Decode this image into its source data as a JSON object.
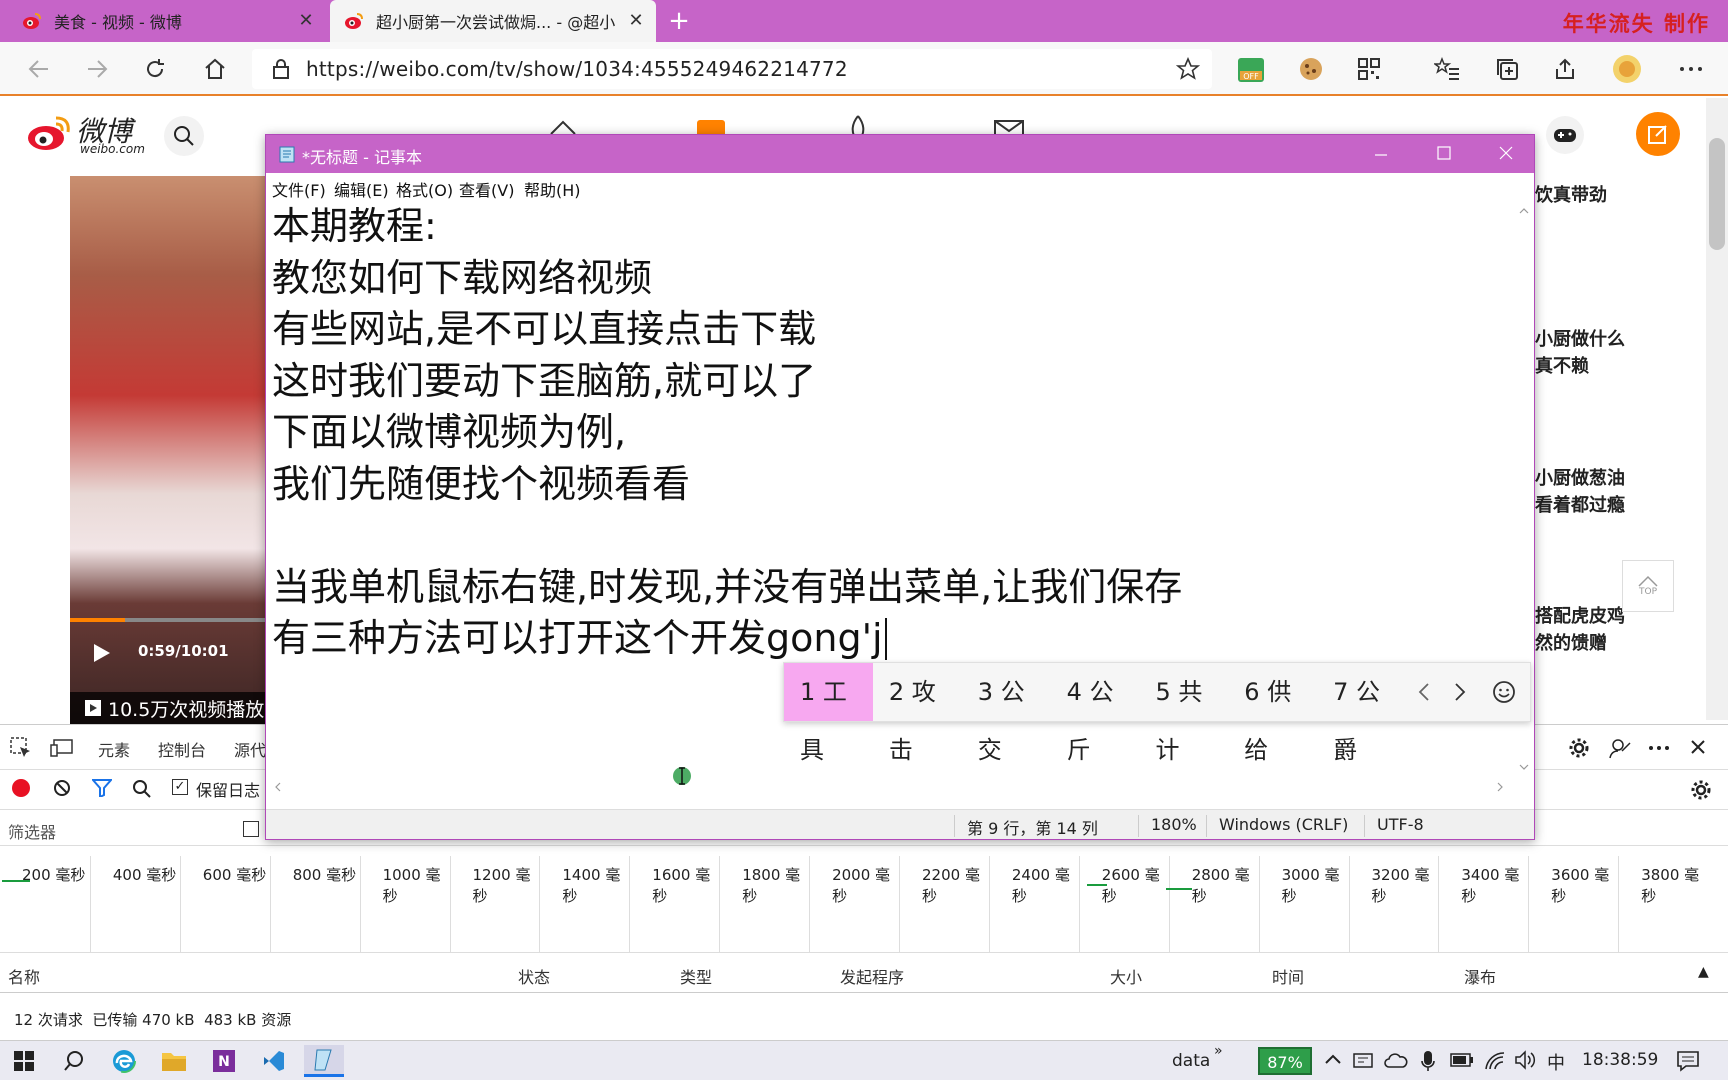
{
  "browser": {
    "tabs": [
      {
        "label": "美食 - 视频 - 微博",
        "icon": "weibo-icon"
      },
      {
        "label": "超小厨第一次尝试做焗... - @超小",
        "icon": "weibo-icon"
      }
    ],
    "new_tab": "+",
    "brand_overlay": "年华流失 制作",
    "url": "https://weibo.com/tv/show/1034:4555249462214772"
  },
  "weibo": {
    "logo_text": "微博",
    "logo_sub": "weibo.com",
    "video_time": "0:59/10:01",
    "play_count": "10.5万次视频播放",
    "right_items": [
      "饮真带劲",
      "小厨做什么",
      "真不赖",
      "小厨做葱油",
      "看着都过瘾",
      "搭配虎皮鸡",
      "然的馈赠"
    ],
    "top_label": "TOP"
  },
  "notepad": {
    "title": "*无标题 - 记事本",
    "menu": [
      "文件(F)",
      "编辑(E)",
      "格式(O)",
      "查看(V)",
      "帮助(H)"
    ],
    "lines": [
      "本期教程:",
      "教您如何下载网络视频",
      "有些网站,是不可以直接点击下载",
      "这时我们要动下歪脑筋,就可以了",
      "下面以微博视频为例,",
      "我们先随便找个视频看看",
      "",
      "当我单机鼠标右键,时发现,并没有弹出菜单,让我们保存",
      "有三种方法可以打开这个开发gong'j"
    ],
    "status": {
      "position": "第 9 行，第 14 列",
      "zoom": "180%",
      "eol": "Windows (CRLF)",
      "encoding": "UTF-8"
    }
  },
  "ime": {
    "candidates": [
      "1 工具",
      "2 攻击",
      "3 公交",
      "4 公斤",
      "5 共计",
      "6 供给",
      "7 公爵"
    ]
  },
  "devtools": {
    "tabs": [
      "元素",
      "控制台",
      "源代"
    ],
    "preserve_log": "保留日志",
    "filter_label": "筛选器",
    "ticks": [
      "200 毫秒",
      "400 毫秒",
      "600 毫秒",
      "800 毫秒",
      "1000 毫秒",
      "1200 毫秒",
      "1400 毫秒",
      "1600 毫秒",
      "1800 毫秒",
      "2000 毫秒",
      "2200 毫秒",
      "2400 毫秒",
      "2600 毫秒",
      "2800 毫秒",
      "3000 毫秒",
      "3200 毫秒",
      "3400 毫秒",
      "3600 毫秒",
      "3800 毫秒"
    ],
    "columns": [
      "名称",
      "状态",
      "类型",
      "发起程序",
      "大小",
      "时间",
      "瀑布"
    ],
    "summary": "12 次请求  已传输 470 kB  483 kB 资源"
  },
  "taskbar": {
    "search_label": "data",
    "battery": "87%",
    "ime_lang": "中",
    "time": "18:38:59"
  }
}
